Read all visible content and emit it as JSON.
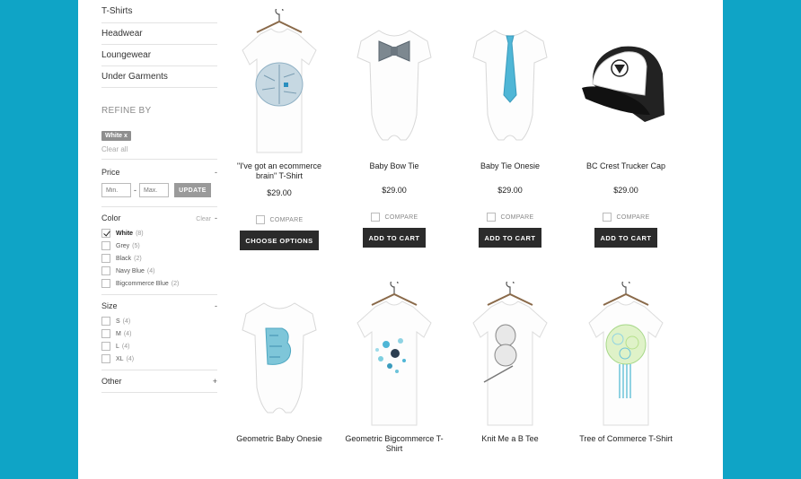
{
  "categories": [
    "T-Shirts",
    "Headwear",
    "Loungewear",
    "Under Garments"
  ],
  "refine": {
    "title": "REFINE BY",
    "active_tag": "White",
    "active_tag_remove": "x",
    "clear_all": "Clear all"
  },
  "price": {
    "title": "Price",
    "toggle": "-",
    "min_placeholder": "Min.",
    "max_placeholder": "Max.",
    "separator": "-",
    "update": "UPDATE"
  },
  "color": {
    "title": "Color",
    "clear": "Clear",
    "toggle": "-",
    "options": [
      {
        "name": "White",
        "count": "(8)",
        "checked": true
      },
      {
        "name": "Grey",
        "count": "(5)",
        "checked": false
      },
      {
        "name": "Black",
        "count": "(2)",
        "checked": false
      },
      {
        "name": "Navy Blue",
        "count": "(4)",
        "checked": false
      },
      {
        "name": "Bigcommerce Blue",
        "count": "(2)",
        "checked": false
      }
    ]
  },
  "size": {
    "title": "Size",
    "toggle": "-",
    "options": [
      {
        "name": "S",
        "count": "(4)"
      },
      {
        "name": "M",
        "count": "(4)"
      },
      {
        "name": "L",
        "count": "(4)"
      },
      {
        "name": "XL",
        "count": "(4)"
      }
    ]
  },
  "other": {
    "title": "Other",
    "toggle": "+"
  },
  "products": [
    {
      "name": "\"I've got an ecommerce brain\" T-Shirt",
      "price": "$29.00",
      "compare": "COMPARE",
      "button": "CHOOSE OPTIONS",
      "image": "brain-tshirt"
    },
    {
      "name": "Baby Bow Tie",
      "price": "$29.00",
      "compare": "COMPARE",
      "button": "ADD TO CART",
      "image": "bow-tie-onesie"
    },
    {
      "name": "Baby Tie Onesie",
      "price": "$29.00",
      "compare": "COMPARE",
      "button": "ADD TO CART",
      "image": "tie-onesie"
    },
    {
      "name": "BC Crest Trucker Cap",
      "price": "$29.00",
      "compare": "COMPARE",
      "button": "ADD TO CART",
      "image": "trucker-cap"
    },
    {
      "name": "Geometric Baby Onesie",
      "image": "geometric-onesie"
    },
    {
      "name": "Geometric Bigcommerce T-Shirt",
      "image": "geometric-tshirt"
    },
    {
      "name": "Knit Me a B Tee",
      "image": "knit-tee"
    },
    {
      "name": "Tree of Commerce T-Shirt",
      "image": "tree-tshirt"
    }
  ],
  "colors": {
    "background": "#0fa4c6",
    "button": "#2b2b2b",
    "accent_blue": "#4fb6d6"
  }
}
